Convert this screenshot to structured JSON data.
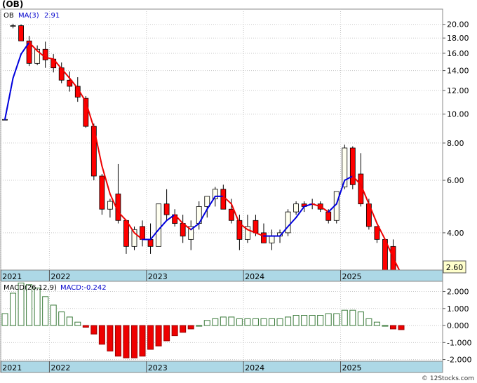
{
  "symbol_label": "(OB)",
  "watermark": "© 12Stocks.com",
  "colors": {
    "up_candle": "#fffff0",
    "down_candle": "#ff0000",
    "ma_up": "#0000dd",
    "ma_down": "#ee0000",
    "macd_pos": "#3a7a3a",
    "macd_neg": "#ee0000",
    "axis_band": "#add8e6",
    "grid": "#c8c8c8"
  },
  "chart_data": [
    {
      "type": "candlestick",
      "title": "",
      "scale": "log",
      "grid": true,
      "ylim": [
        3.0,
        22.5
      ],
      "yticks": [
        "20.00",
        "18.00",
        "16.00",
        "14.00",
        "12.00",
        "10.00",
        "8.00",
        "6.00",
        "4.00"
      ],
      "xticks": [
        "2021",
        "2022",
        "2023",
        "2024",
        "2025"
      ],
      "legend": {
        "symbol": "OB",
        "ma_label": "MA(3)",
        "ma_value": "2.91"
      },
      "last_price": "2.60",
      "ohlc": [
        [
          9.6,
          9.6,
          9.6,
          9.6
        ],
        [
          19.7,
          20.1,
          19.4,
          19.8
        ],
        [
          19.8,
          20.0,
          17.6,
          17.6
        ],
        [
          17.6,
          18.3,
          14.5,
          14.8
        ],
        [
          14.8,
          17.0,
          14.6,
          16.5
        ],
        [
          16.5,
          17.5,
          14.3,
          15.2
        ],
        [
          15.3,
          15.9,
          13.8,
          14.3
        ],
        [
          14.3,
          14.9,
          12.7,
          13.0
        ],
        [
          13.0,
          13.9,
          11.9,
          12.4
        ],
        [
          12.4,
          13.3,
          11.0,
          11.4
        ],
        [
          11.3,
          11.5,
          9.0,
          9.1
        ],
        [
          9.1,
          9.3,
          6.0,
          6.2
        ],
        [
          6.2,
          6.3,
          4.6,
          4.8
        ],
        [
          4.8,
          5.2,
          4.5,
          5.1
        ],
        [
          5.4,
          6.8,
          4.3,
          4.4
        ],
        [
          4.4,
          4.4,
          3.4,
          3.6
        ],
        [
          3.6,
          4.2,
          3.5,
          4.1
        ],
        [
          4.2,
          4.4,
          3.6,
          3.8
        ],
        [
          3.8,
          4.3,
          3.4,
          3.6
        ],
        [
          3.6,
          5.0,
          3.6,
          5.0
        ],
        [
          5.0,
          5.6,
          4.4,
          4.6
        ],
        [
          4.6,
          4.8,
          4.2,
          4.3
        ],
        [
          4.3,
          4.6,
          3.7,
          3.9
        ],
        [
          3.8,
          4.4,
          3.5,
          4.2
        ],
        [
          4.3,
          5.1,
          4.1,
          4.9
        ],
        [
          4.9,
          5.3,
          4.5,
          5.3
        ],
        [
          5.2,
          5.7,
          4.9,
          5.6
        ],
        [
          5.6,
          5.8,
          4.8,
          4.8
        ],
        [
          4.8,
          5.2,
          4.3,
          4.4
        ],
        [
          4.4,
          4.6,
          3.5,
          3.8
        ],
        [
          3.8,
          4.6,
          3.7,
          4.2
        ],
        [
          4.4,
          4.6,
          3.9,
          4.0
        ],
        [
          4.0,
          4.3,
          3.7,
          3.7
        ],
        [
          3.7,
          4.1,
          3.5,
          3.9
        ],
        [
          3.9,
          4.1,
          3.7,
          4.0
        ],
        [
          4.0,
          4.8,
          3.9,
          4.7
        ],
        [
          4.7,
          5.1,
          4.6,
          5.0
        ],
        [
          5.0,
          5.1,
          4.7,
          4.9
        ],
        [
          5.0,
          5.2,
          4.8,
          5.0
        ],
        [
          5.0,
          5.1,
          4.7,
          4.8
        ],
        [
          4.7,
          4.8,
          4.3,
          4.4
        ],
        [
          4.4,
          5.4,
          4.3,
          5.5
        ],
        [
          5.7,
          7.9,
          5.6,
          7.7
        ],
        [
          7.7,
          7.8,
          5.6,
          5.8
        ],
        [
          6.3,
          7.4,
          4.9,
          5.0
        ],
        [
          5.0,
          5.2,
          4.1,
          4.2
        ],
        [
          4.2,
          4.2,
          3.7,
          3.8
        ],
        [
          3.8,
          3.8,
          3.0,
          3.0
        ],
        [
          3.6,
          3.8,
          2.6,
          2.6
        ],
        [
          2.6,
          2.8,
          2.5,
          2.7
        ]
      ],
      "ma3": [
        9.6,
        13.2,
        15.9,
        17.4,
        16.3,
        15.5,
        15.3,
        14.2,
        13.2,
        12.2,
        11.0,
        9.0,
        6.7,
        5.4,
        4.7,
        4.4,
        4.0,
        3.8,
        3.8,
        4.1,
        4.4,
        4.6,
        4.3,
        4.1,
        4.3,
        4.8,
        5.3,
        5.3,
        5.0,
        4.3,
        4.1,
        4.0,
        3.9,
        3.9,
        3.9,
        4.2,
        4.5,
        4.9,
        5.0,
        4.9,
        4.7,
        5.0,
        6.0,
        6.2,
        5.8,
        5.0,
        4.3,
        3.8,
        3.3,
        2.91
      ]
    },
    {
      "type": "bar",
      "title": "",
      "legend": {
        "macd_label": "MACD(26,12,9)",
        "macd_value": "MACD:-0.242"
      },
      "ylim": [
        -2.1,
        2.6
      ],
      "yticks": [
        "2.000",
        "1.000",
        "0.000",
        "-1.000",
        "-2.000"
      ],
      "xticks": [
        "2021",
        "2022",
        "2023",
        "2024",
        "2025"
      ],
      "values": [
        0.7,
        1.9,
        2.5,
        2.4,
        2.2,
        1.7,
        1.2,
        0.8,
        0.5,
        0.2,
        -0.1,
        -0.5,
        -1.1,
        -1.5,
        -1.8,
        -1.9,
        -1.9,
        -1.8,
        -1.4,
        -1.2,
        -0.9,
        -0.6,
        -0.4,
        -0.2,
        0.0,
        0.3,
        0.4,
        0.5,
        0.5,
        0.4,
        0.4,
        0.4,
        0.4,
        0.4,
        0.4,
        0.5,
        0.6,
        0.6,
        0.6,
        0.6,
        0.7,
        0.7,
        0.9,
        0.9,
        0.8,
        0.4,
        0.2,
        0.0,
        -0.2,
        -0.242
      ]
    }
  ]
}
